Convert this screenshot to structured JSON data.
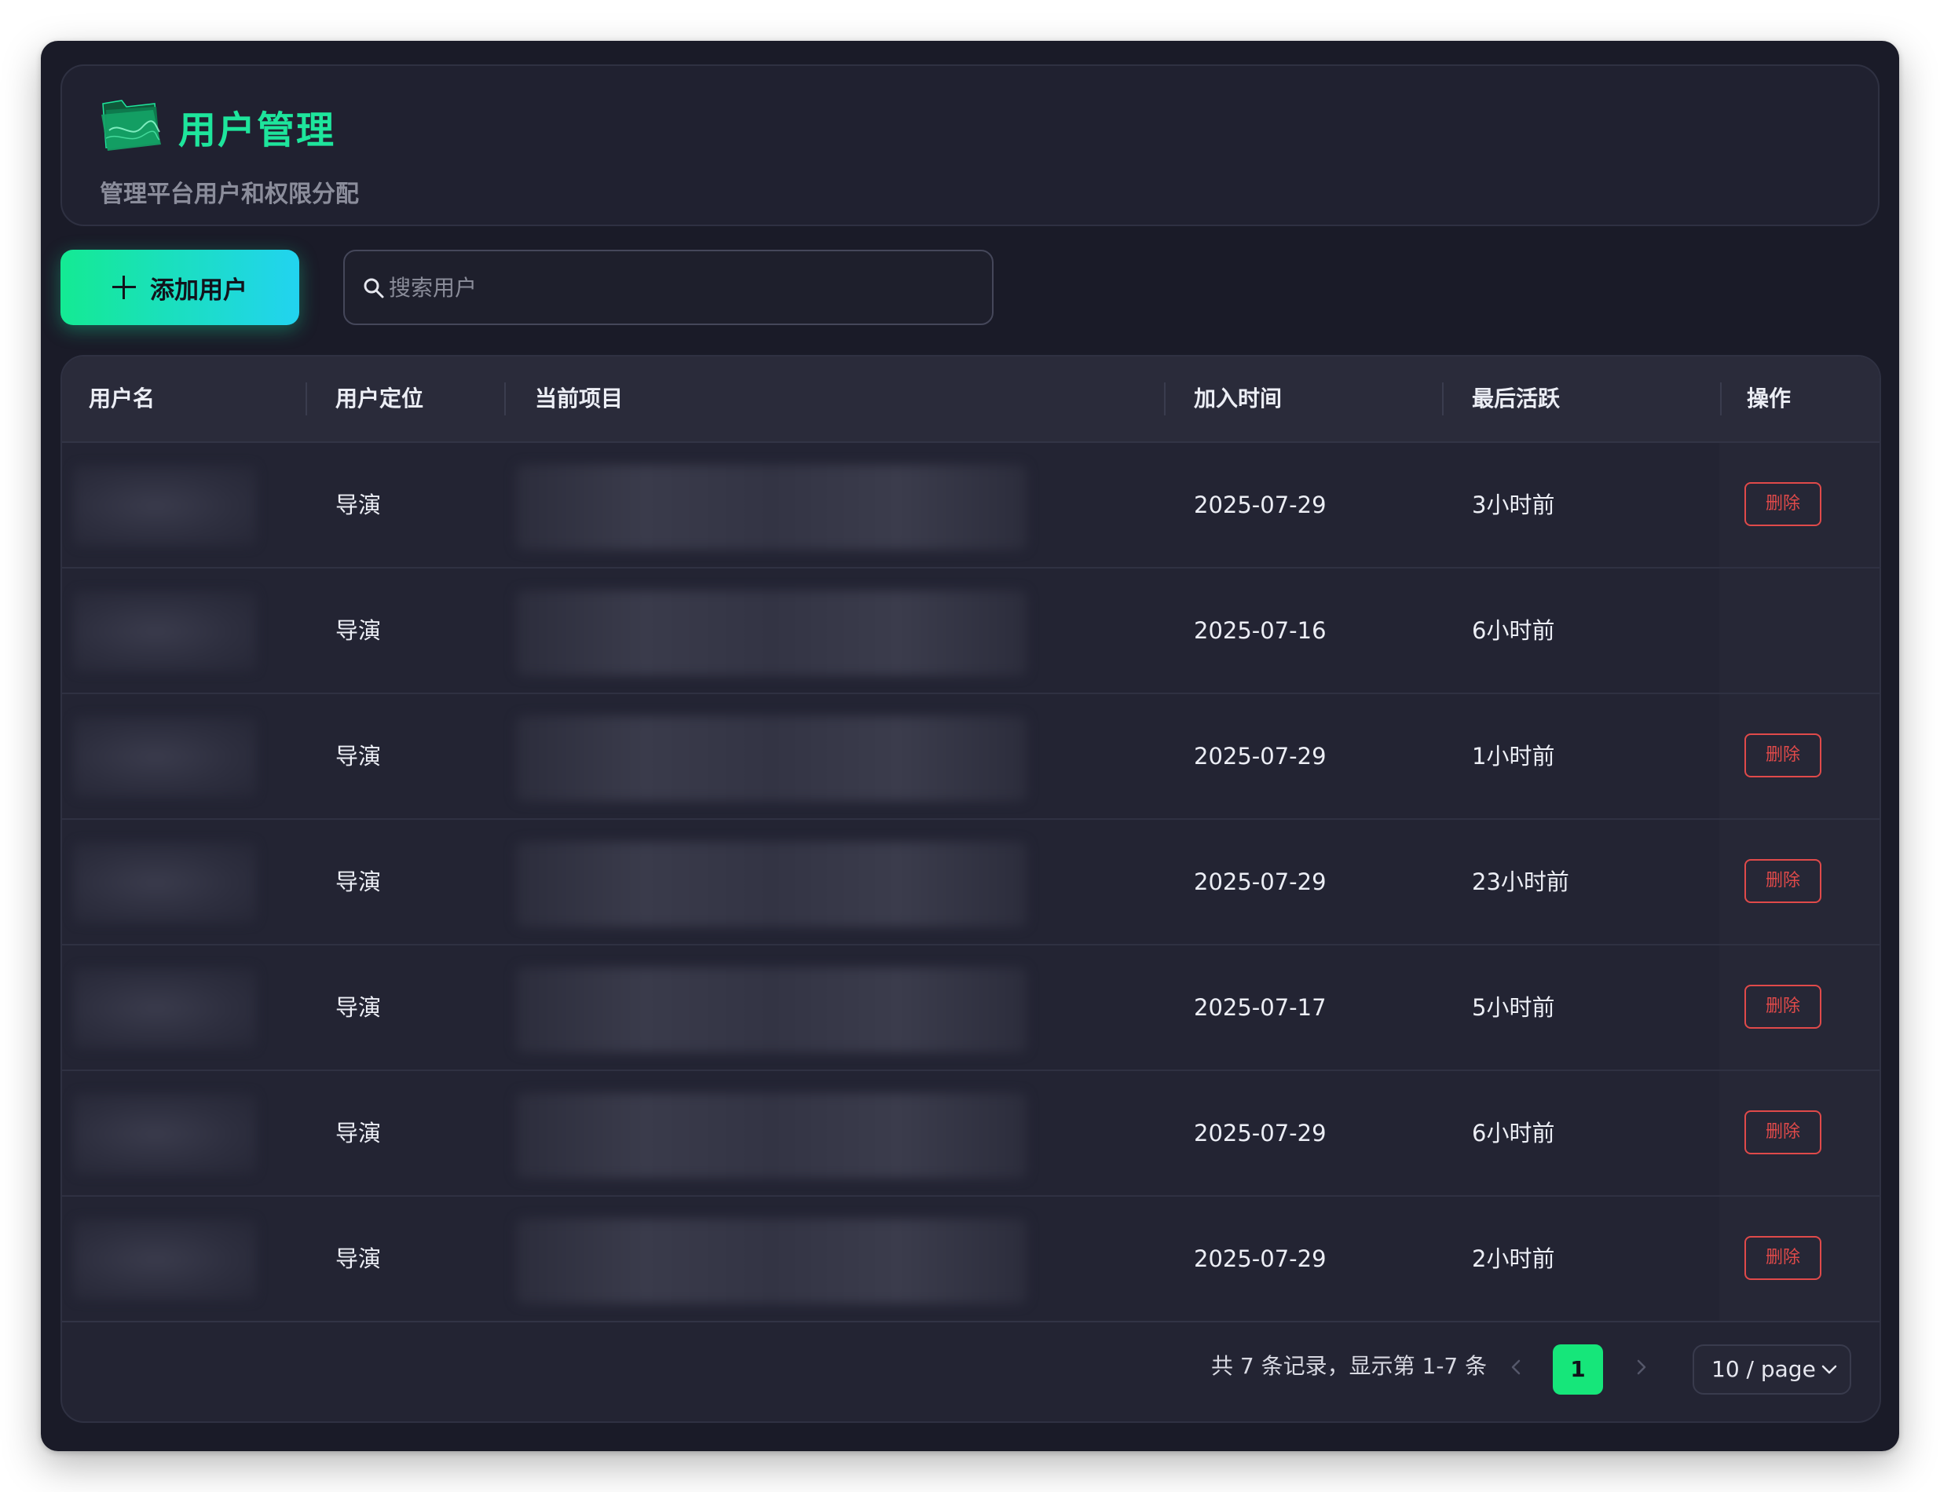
{
  "header": {
    "title": "用户管理",
    "subtitle": "管理平台用户和权限分配",
    "icon": "folder-icon"
  },
  "toolbar": {
    "add_label": "添加用户",
    "search_placeholder": "搜索用户"
  },
  "table": {
    "columns": [
      "用户名",
      "用户定位",
      "当前项目",
      "加入时间",
      "最后活跃",
      "操作"
    ],
    "rows": [
      {
        "role": "导演",
        "joined": "2025-07-29",
        "last_active": "3小时前",
        "action": "删除"
      },
      {
        "role": "导演",
        "joined": "2025-07-16",
        "last_active": "6小时前",
        "action": ""
      },
      {
        "role": "导演",
        "joined": "2025-07-29",
        "last_active": "1小时前",
        "action": "删除"
      },
      {
        "role": "导演",
        "joined": "2025-07-29",
        "last_active": "23小时前",
        "action": "删除"
      },
      {
        "role": "导演",
        "joined": "2025-07-17",
        "last_active": "5小时前",
        "action": "删除"
      },
      {
        "role": "导演",
        "joined": "2025-07-29",
        "last_active": "6小时前",
        "action": "删除"
      },
      {
        "role": "导演",
        "joined": "2025-07-29",
        "last_active": "2小时前",
        "action": "删除"
      }
    ]
  },
  "pagination": {
    "summary": "共 7 条记录，显示第 1-7 条",
    "current_page": "1",
    "page_size": "10 / page"
  },
  "colors": {
    "accent": "#1ee59c",
    "danger": "#e04a4a",
    "background": "#1a1b28"
  }
}
